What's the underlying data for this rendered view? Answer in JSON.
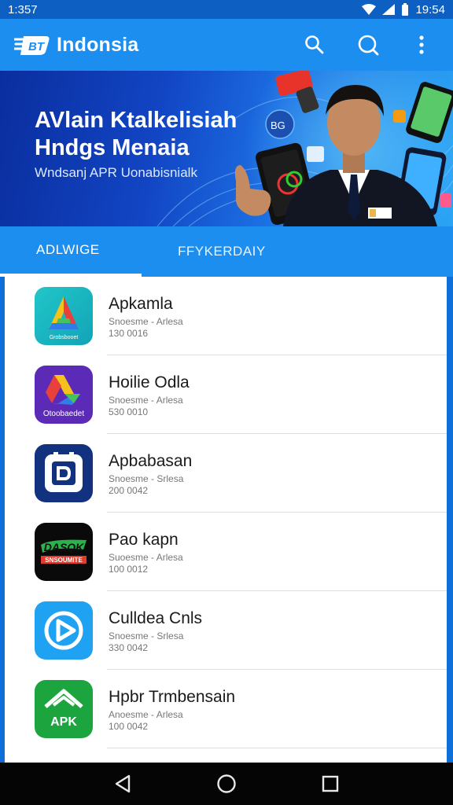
{
  "status": {
    "time": "1:357",
    "clock_right": "19:54"
  },
  "app_bar": {
    "title": "Indonsia",
    "logo_text": "BT"
  },
  "banner": {
    "heading": "AVlain Ktalkelisiah Hndgs Menaia",
    "subheading": "Wndsanj APR Uonabisnialk",
    "badge": "BG"
  },
  "tabs": [
    {
      "label": "ADLWIGE",
      "selected": true
    },
    {
      "label": "FFYKERDAIY",
      "selected": false
    }
  ],
  "apps": [
    {
      "name": "Apkamla",
      "meta": "Snoesme - Arlesa",
      "size": "130 0016",
      "icon": "colorful-a-icon",
      "icon_text": "Grobsbooet"
    },
    {
      "name": "Hoilie Odla",
      "meta": "Snoesme - Arlesa",
      "size": "530 0010",
      "icon": "purple-drive-icon",
      "icon_text": "Otoobaedet"
    },
    {
      "name": "Apbabasan",
      "meta": "Snoesme - Srlesa",
      "size": "200 0042",
      "icon": "navy-d-icon"
    },
    {
      "name": "Pao kapn",
      "meta": "Suoesme - Arlesa",
      "size": "100 0012",
      "icon": "dark-brand-icon",
      "icon_text": "DASQK",
      "icon_text2": "SNSOUMITE"
    },
    {
      "name": "Culldea Cnls",
      "meta": "Snoesme - Srlesa",
      "size": "330 0042",
      "icon": "blue-play-icon"
    },
    {
      "name": "Hpbr Trmbensain",
      "meta": "Anoesme - Arlesa",
      "size": "100 0042",
      "icon": "green-apk-icon",
      "icon_text": "APK"
    }
  ],
  "colors": {
    "primary": "#1c8ef0",
    "status_bar": "#0d5fc2",
    "nav_bar": "#050505"
  }
}
